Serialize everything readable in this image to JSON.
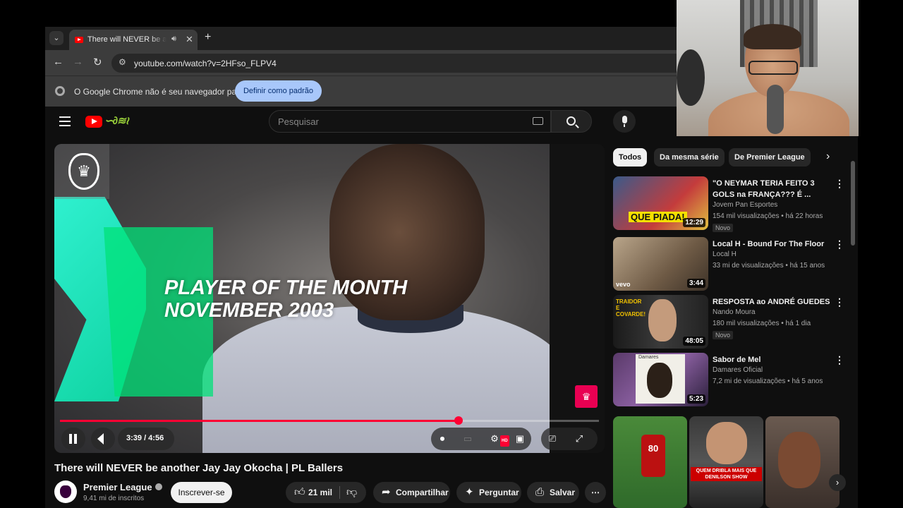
{
  "browser": {
    "tab_title": "There will NEVER be another Jay Jay Okocha | PL Ballers",
    "url": "youtube.com/watch?v=2HFso_FLPV4",
    "infobar_message": "O Google Chrome não é seu navegador padrão",
    "infobar_button": "Definir como padrão"
  },
  "youtube": {
    "search_placeholder": "Pesquisar",
    "player": {
      "overlay_line1": "PLAYER OF THE MONTH",
      "overlay_line2": "NOVEMBER 2003",
      "time": "3:39 / 4:56",
      "progress_fraction": 0.74
    },
    "video": {
      "title": "There will NEVER be another Jay Jay Okocha | PL Ballers",
      "channel": "Premier League",
      "subscribers": "9,41 mi de inscritos",
      "subscribe_label": "Inscrever-se",
      "likes": "21 mil",
      "share_label": "Compartilhar",
      "ask_label": "Perguntar",
      "save_label": "Salvar"
    },
    "chips": [
      "Todos",
      "Da mesma série",
      "De Premier League"
    ],
    "recommendations": [
      {
        "title": "\"O NEYMAR TERIA FEITO 3 GOLS na FRANÇA??? É ...",
        "channel": "Jovem Pan Esportes",
        "meta": "154 mil visualizações • há 22 horas",
        "badge": "Novo",
        "duration": "12:29",
        "thumb_text": "QUE PIADA!"
      },
      {
        "title": "Local H - Bound For The Floor",
        "channel": "Local H",
        "meta": "33 mi de visualizações • há 15 anos",
        "badge": "",
        "duration": "3:44",
        "thumb_text": "vevo"
      },
      {
        "title": "RESPOSTA ao ANDRÉ GUEDES",
        "channel": "Nando Moura",
        "meta": "180 mil visualizações • há 1 dia",
        "badge": "Novo",
        "duration": "48:05",
        "thumb_text": "TRAIDOR E COVARDE!"
      },
      {
        "title": "Sabor de Mel",
        "channel": "Damares Oficial",
        "meta": "7,2 mi de visualizações • há 5 anos",
        "badge": "",
        "duration": "5:23",
        "thumb_text": "Damares"
      }
    ],
    "shorts": {
      "short2_text": "QUEM DRIBLA MAIS QUE DENILSON SHOW",
      "short1_number": "80"
    }
  },
  "colors": {
    "yt_red": "#ff0033",
    "pl_teal": "#2ff0cf",
    "pl_magenta": "#e90052",
    "chrome_blue_button": "#a8c7fa"
  }
}
